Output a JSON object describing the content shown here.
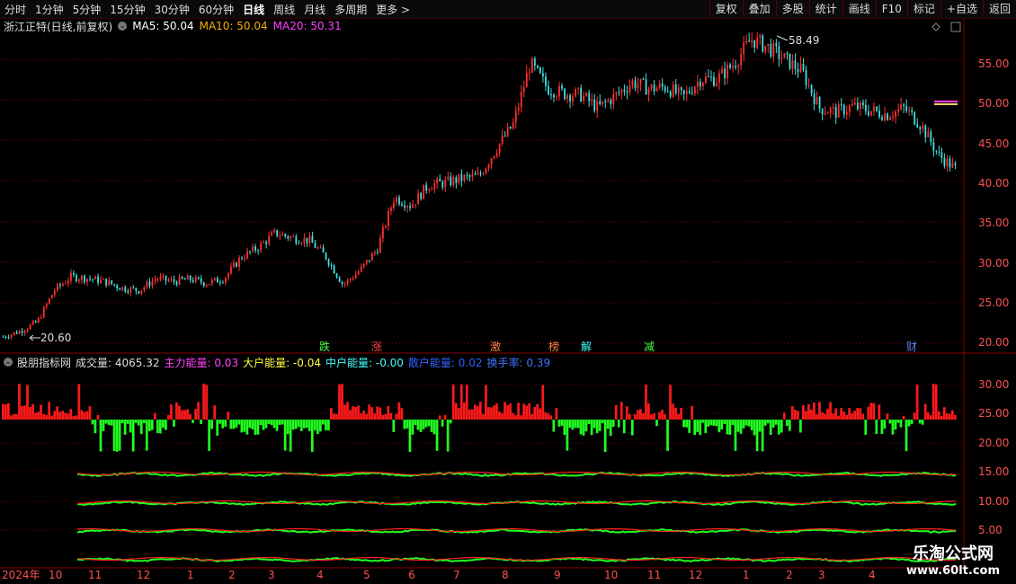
{
  "toolbar": {
    "periods": [
      "分时",
      "1分钟",
      "5分钟",
      "15分钟",
      "30分钟",
      "60分钟",
      "日线",
      "周线",
      "月线",
      "多周期",
      "更多 >"
    ],
    "active_index": 6,
    "right_buttons": [
      "复权",
      "叠加",
      "多股",
      "统计",
      "画线",
      "F10",
      "标记",
      "+自选",
      "返回"
    ]
  },
  "main": {
    "stock_label": "浙江正特(日线,前复权)",
    "ma5_label": "MA5: 50.04",
    "ma10_label": "MA10: 50.04",
    "ma20_label": "MA20: 50.31",
    "high_label": "58.49",
    "low_label": "20.60",
    "yaxis_labels": [
      "55.00",
      "50.00",
      "45.00",
      "40.00",
      "35.00",
      "30.00",
      "25.00",
      "20.00"
    ]
  },
  "events": [
    {
      "text": "跌",
      "color": "#40ff40"
    },
    {
      "text": "涨",
      "color": "#ff4040"
    },
    {
      "text": "激",
      "color": "#ff8040"
    },
    {
      "text": "榜",
      "color": "#ff8040"
    },
    {
      "text": "解",
      "color": "#40ffff"
    },
    {
      "text": "减",
      "color": "#40ff40"
    },
    {
      "text": "财",
      "color": "#6080ff"
    }
  ],
  "indicator": {
    "name": "股朋指标网",
    "vol_label": "成交量: 4065.32",
    "main_label": "主力能量: 0.03",
    "big_label": "大户能量: -0.04",
    "mid_label": "中户能量: -0.00",
    "retail_label": "散户能量: 0.02",
    "turnover_label": "换手率: 0.39",
    "yaxis_labels": [
      "30.00",
      "25.00",
      "20.00",
      "15.00",
      "10.00",
      "5.00"
    ]
  },
  "xaxis": {
    "labels": [
      "2024年",
      "10",
      "11",
      "12",
      "1",
      "2",
      "3",
      "4",
      "5",
      "6",
      "7",
      "8",
      "9",
      "10",
      "11",
      "12",
      "1",
      "2",
      "3",
      "4"
    ]
  },
  "watermark": {
    "line1": "乐淘公式网",
    "line2": "www.60lt.com"
  },
  "chart_data": {
    "type": "candlestick",
    "ylim": [
      19,
      59
    ],
    "series": [
      {
        "name": "price_path",
        "values": [
          20.8,
          21.5,
          22.6,
          26.5,
          28.2,
          28.0,
          27.6,
          26.8,
          26.5,
          28.0,
          27.6,
          27.9,
          27.4,
          28.0,
          30.6,
          31.8,
          33.6,
          33.0,
          32.7,
          30.6,
          27.2,
          29.0,
          31.6,
          38.0,
          37.0,
          39.5,
          39.8,
          40.3,
          40.6,
          44.0,
          47.0,
          54.5,
          51.5,
          50.8,
          50.6,
          49.0,
          50.5,
          52.2,
          51.4,
          51.6,
          50.3,
          52.6,
          52.6,
          54.5,
          57.5,
          56.5,
          55.0,
          53.5,
          49.0,
          48.5,
          49.2,
          48.7,
          48.2,
          49.0,
          46.9,
          43.2,
          41.5
        ]
      }
    ]
  }
}
